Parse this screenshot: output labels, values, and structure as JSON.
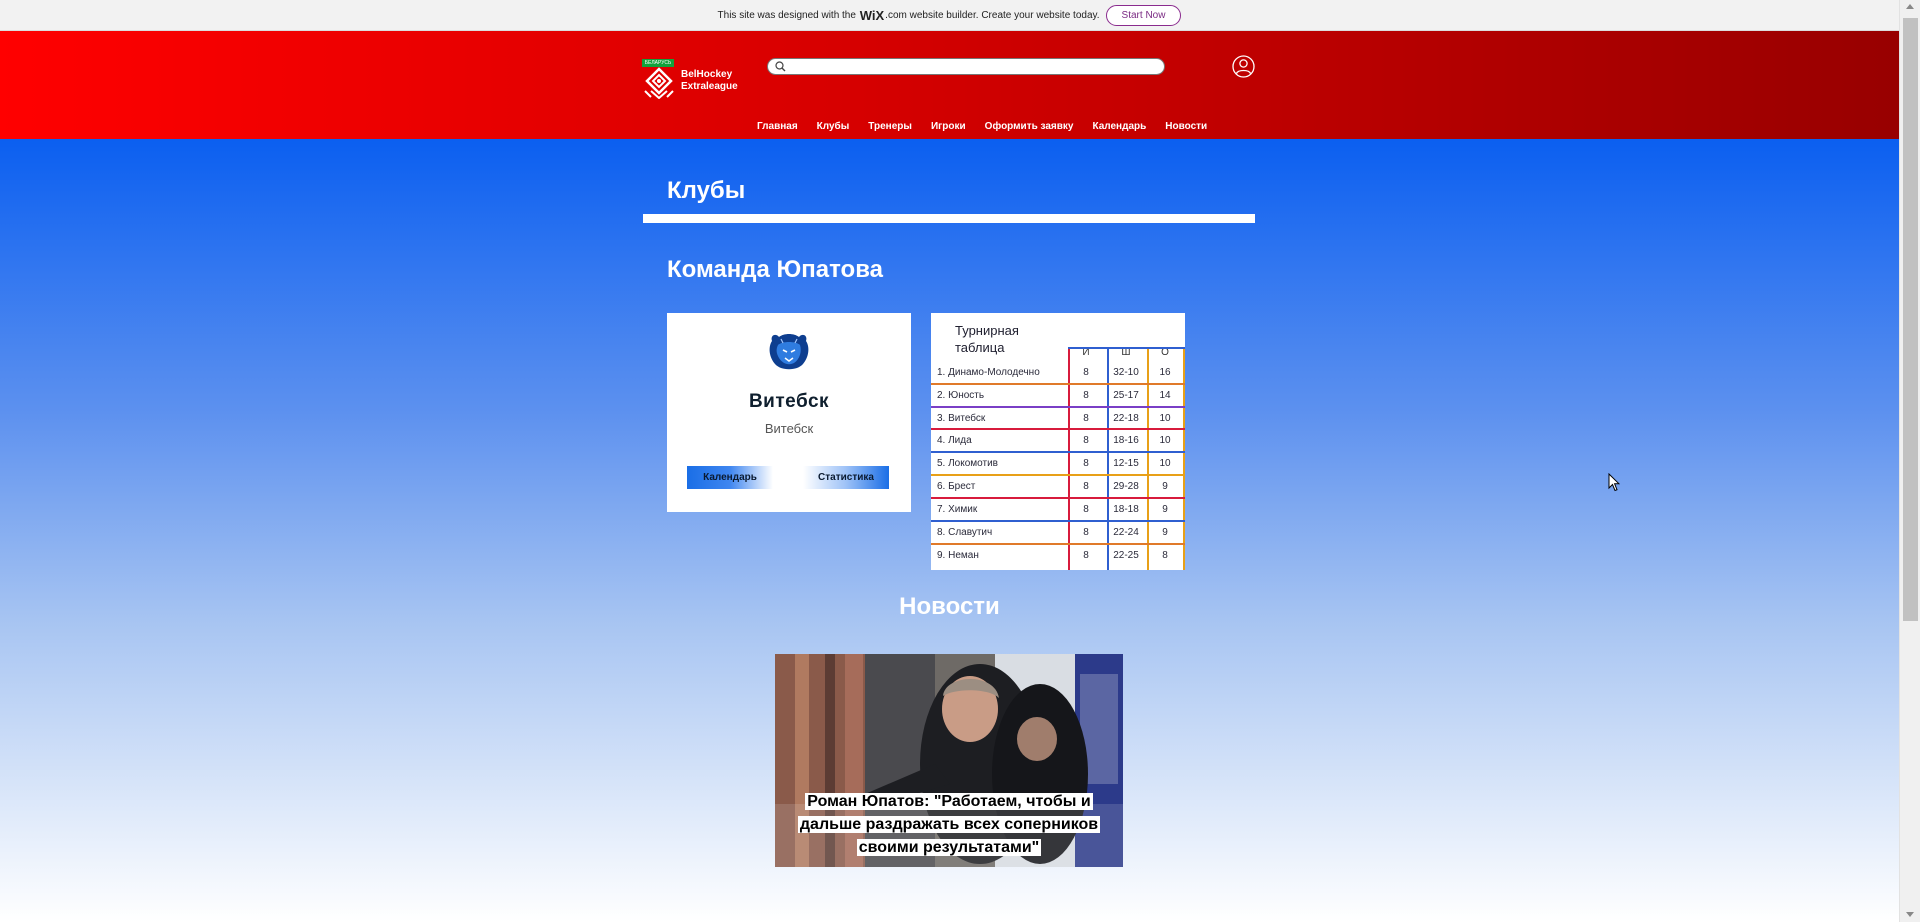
{
  "wix_banner": {
    "text_before": "This site was designed with the",
    "wix_logo": "WiX",
    "text_after": ".com website builder. Create your website today.",
    "start_now": "Start Now"
  },
  "header": {
    "logo_flag": "БЕЛАРУСЬ",
    "logo_line1": "BelHockey",
    "logo_line2": "Extraleague",
    "search_placeholder": "",
    "nav": [
      "Главная",
      "Клубы",
      "Тренеры",
      "Игроки",
      "Оформить заявку",
      "Календарь",
      "Новости"
    ]
  },
  "page": {
    "title": "Клубы",
    "team_heading": "Команда Юпатова"
  },
  "club": {
    "name": "Витебск",
    "city": "Витебск",
    "calendar_button": "Календарь",
    "stats_button": "Статистика"
  },
  "standings": {
    "title_line1": "Турнирная",
    "title_line2": "таблица",
    "headers": [
      "И",
      "Ш",
      "О"
    ],
    "rows": [
      {
        "name": "1. Динамо-Молодечно",
        "games": "8",
        "score": "32-10",
        "points": "16"
      },
      {
        "name": "2. Юность",
        "games": "8",
        "score": "25-17",
        "points": "14"
      },
      {
        "name": "3. Витебск",
        "games": "8",
        "score": "22-18",
        "points": "10"
      },
      {
        "name": "4. Лида",
        "games": "8",
        "score": "18-16",
        "points": "10"
      },
      {
        "name": "5. Локомотив",
        "games": "8",
        "score": "12-15",
        "points": "10"
      },
      {
        "name": "6. Брест",
        "games": "8",
        "score": "29-28",
        "points": "9"
      },
      {
        "name": "7. Химик",
        "games": "8",
        "score": "18-18",
        "points": "9"
      },
      {
        "name": "8. Славутич",
        "games": "8",
        "score": "22-24",
        "points": "9"
      },
      {
        "name": "9. Неман",
        "games": "8",
        "score": "22-25",
        "points": "8"
      }
    ]
  },
  "news": {
    "heading": "Новости",
    "article_title": "Роман Юпатов: \"Работаем, чтобы и дальше раздражать всех соперников своими результатами\""
  },
  "colors": {
    "header_red": "#e00000",
    "main_blue": "#0b5ff0",
    "accent_purple": "#8a2b8e"
  }
}
